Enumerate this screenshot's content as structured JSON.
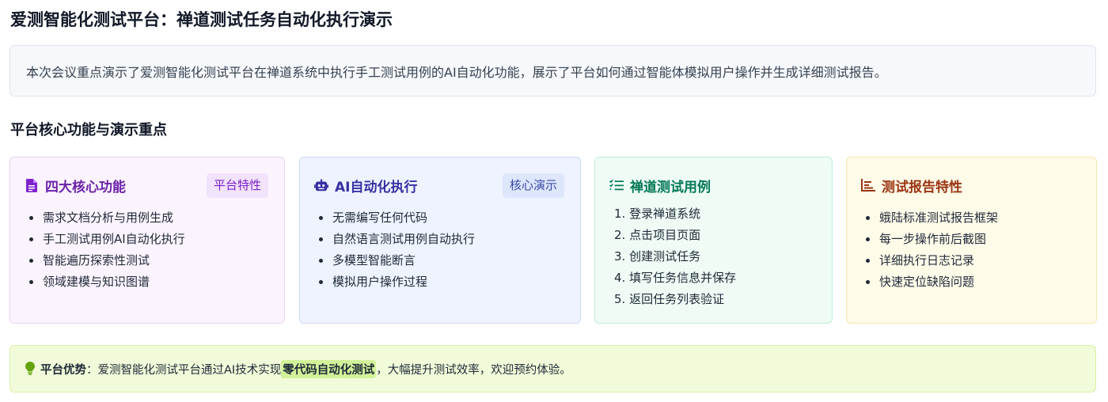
{
  "page": {
    "title": "爱测智能化测试平台：禅道测试任务自动化执行演示",
    "summary": "本次会议重点演示了爱测智能化测试平台在禅道系统中执行手工测试用例的AI自动化功能，展示了平台如何通过智能体模拟用户操作并生成详细测试报告。",
    "section_title": "平台核心功能与演示重点"
  },
  "cards": [
    {
      "icon": "document-icon",
      "title": "四大核心功能",
      "badge": "平台特性",
      "items": [
        "需求文档分析与用例生成",
        "手工测试用例AI自动化执行",
        "智能遍历探索性测试",
        "领域建模与知识图谱"
      ]
    },
    {
      "icon": "robot-icon",
      "title": "AI自动化执行",
      "badge": "核心演示",
      "items": [
        "无需编写任何代码",
        "自然语言测试用例自动执行",
        "多模型智能断言",
        "模拟用户操作过程"
      ]
    },
    {
      "icon": "checklist-icon",
      "title": "禅道测试用例",
      "items": [
        "1. 登录禅道系统",
        "2. 点击项目页面",
        "3. 创建测试任务",
        "4. 填写任务信息并保存",
        "5. 返回任务列表验证"
      ]
    },
    {
      "icon": "bar-chart-icon",
      "title": "测试报告特性",
      "items": [
        "蛾陆标准测试报告框架",
        "每一步操作前后截图",
        "详细执行日志记录",
        "快速定位缺陷问题"
      ]
    }
  ],
  "advantage": {
    "icon": "lightbulb-icon",
    "label": "平台优势",
    "colon": "：",
    "text_before": "爱测智能化测试平台通过AI技术实现",
    "highlight": "零代码自动化测试",
    "text_after": "，大幅提升测试效率，欢迎预约体验。"
  },
  "colors": {
    "purple_accent": "#6b21a8",
    "blue_accent": "#3730a3",
    "green_accent": "#047857",
    "orange_accent": "#9a3412",
    "highlight_bg": "#d2f29a"
  }
}
